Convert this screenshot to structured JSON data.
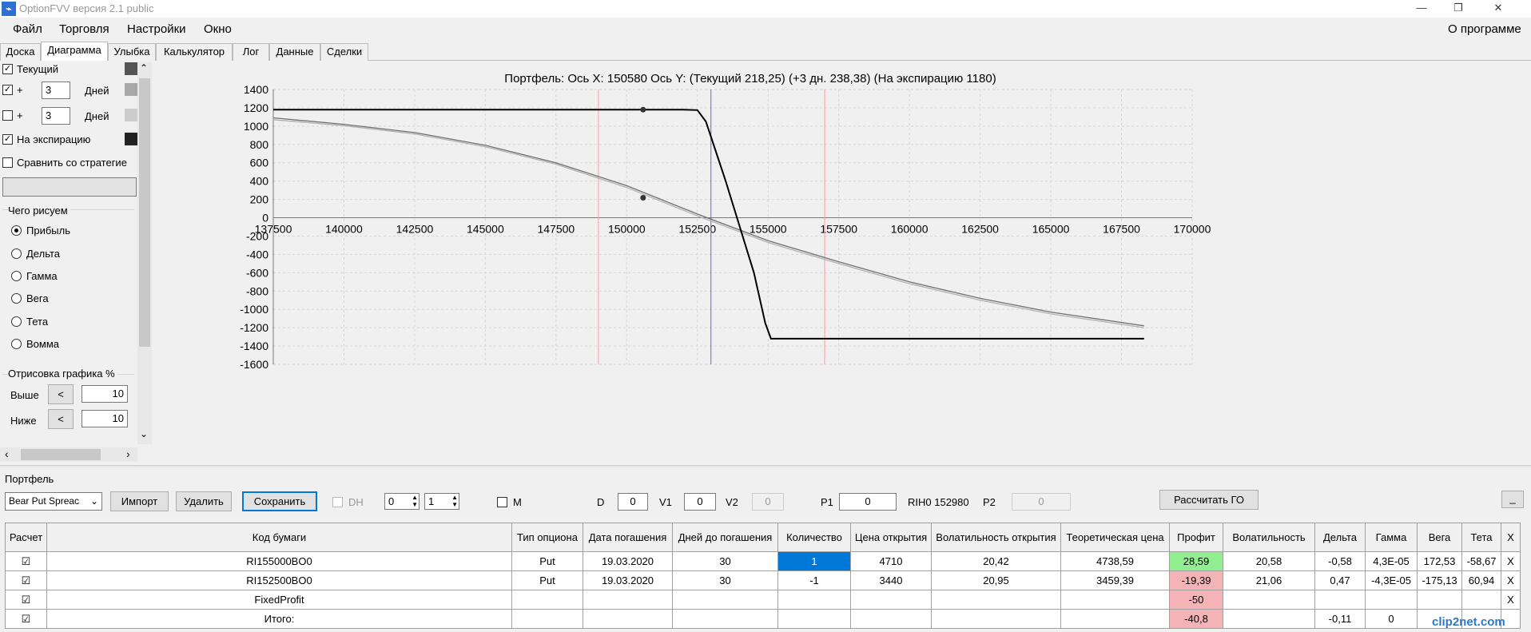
{
  "window": {
    "title": "OptionFVV версия 2.1 public",
    "app_icon": "chart-icon",
    "minimize": "—",
    "restore": "❐",
    "close": "✕"
  },
  "menu": {
    "items": [
      "Файл",
      "Торговля",
      "Настройки",
      "Окно"
    ],
    "about": "О программе"
  },
  "tabs": [
    "Доска",
    "Диаграмма",
    "Улыбка",
    "Калькулятор",
    "Лог",
    "Данные",
    "Сделки"
  ],
  "active_tab": "Диаграмма",
  "sidebar": {
    "current_label": "Текущий",
    "current_checked": true,
    "plus1": {
      "checked": true,
      "sign": "+",
      "days": "3",
      "unit": "Дней"
    },
    "plus2": {
      "checked": false,
      "sign": "+",
      "days": "3",
      "unit": "Дней"
    },
    "expiry_label": "На экспирацию",
    "expiry_checked": true,
    "compare_label": "Сравнить со стратегие",
    "compare_checked": false,
    "draw_group_title": "Чего рисуем",
    "draw_options": [
      "Прибыль",
      "Дельта",
      "Гамма",
      "Вега",
      "Тета",
      "Вомма"
    ],
    "draw_selected": "Прибыль",
    "render_group_title": "Отрисовка графика %",
    "above_label": "Выше",
    "above_btn": "<",
    "above_value": "10",
    "below_label": "Ниже",
    "below_btn": "<",
    "below_value": "10",
    "swatch_colors": [
      "#555555",
      "#a8a8a8",
      "#cccccc",
      "#222222"
    ],
    "scroll_up": "⌃",
    "scroll_down": "⌄",
    "scroll_left": "‹",
    "scroll_right": "›"
  },
  "chart_data": {
    "type": "line",
    "title": "Портфель: Ось X: 150580 Ось Y:  (Текущий 218,25)  (+3 дн. 238,38)  (На экспирацию 1180)",
    "x_ticks": [
      "137500",
      "140000",
      "142500",
      "145000",
      "147500",
      "150000",
      "152500",
      "155000",
      "157500",
      "160000",
      "162500",
      "165000",
      "167500",
      "170000"
    ],
    "y_ticks": [
      "1400",
      "1200",
      "1000",
      "800",
      "600",
      "400",
      "200",
      "0",
      "-200",
      "-400",
      "-600",
      "-800",
      "-1000",
      "-1200",
      "-1400",
      "-1600"
    ],
    "xlim": [
      137500,
      170000
    ],
    "ylim": [
      -1600,
      1400
    ],
    "grid": true,
    "vertical_lines": [
      {
        "x": 149000,
        "color": "#ff9aaa"
      },
      {
        "x": 152980,
        "color": "#6b6bb5"
      },
      {
        "x": 157000,
        "color": "#ff9aaa"
      }
    ],
    "markers": [
      {
        "x": 150580,
        "y": 1180
      },
      {
        "x": 150580,
        "y": 218
      }
    ],
    "series": [
      {
        "color": "#000000",
        "x": [
          137500,
          152000,
          152500,
          152800,
          153500,
          154500,
          154900,
          155100,
          168300
        ],
        "y": [
          1180,
          1180,
          1175,
          1050,
          400,
          -600,
          -1150,
          -1320,
          -1320
        ]
      },
      {
        "color": "#707070",
        "x": [
          137500,
          140000,
          142500,
          145000,
          147500,
          150000,
          152500,
          155000,
          157500,
          160000,
          162500,
          165000,
          168300
        ],
        "y": [
          1090,
          1020,
          930,
          790,
          600,
          350,
          40,
          -250,
          -480,
          -700,
          -880,
          -1030,
          -1180
        ]
      },
      {
        "color": "#b0b0b0",
        "x": [
          137500,
          140000,
          142500,
          145000,
          147500,
          150000,
          152500,
          155000,
          157500,
          160000,
          162500,
          165000,
          168300
        ],
        "y": [
          1070,
          1005,
          915,
          775,
          585,
          330,
          20,
          -270,
          -500,
          -720,
          -900,
          -1050,
          -1200
        ]
      }
    ]
  },
  "portfolio": {
    "section_label": "Портфель",
    "strategy_select": "Bear Put Spreac",
    "import_btn": "Импорт",
    "delete_btn": "Удалить",
    "save_btn": "Сохранить",
    "dh_label": "DH",
    "spin1": "0",
    "spin2": "1",
    "m_label": "M",
    "d_label": "D",
    "d_value": "0",
    "v1_label": "V1",
    "v1_value": "0",
    "v2_label": "V2",
    "v2_value": "0",
    "p1_label": "P1",
    "p1_value": "0",
    "rih_label": "RIH0 152980",
    "p2_label": "P2",
    "p2_value": "0",
    "calc_btn": "Рассчитать ГО",
    "collapse_btn": "_"
  },
  "table": {
    "columns": [
      "Расчет",
      "Код бумаги",
      "Тип опциона",
      "Дата погашения",
      "Дней до погашения",
      "Количество",
      "Цена открытия",
      "Волатильность открытия",
      "Теоретическая цена",
      "Профит",
      "Волатильность",
      "Дельта",
      "Гамма",
      "Вега",
      "Тета",
      "X"
    ],
    "rows": [
      {
        "check": "☑",
        "cells": [
          "RI155000BO0",
          "Put",
          "19.03.2020",
          "30",
          "1",
          "4710",
          "20,42",
          "4738,59",
          "28,59",
          "20,58",
          "-0,58",
          "4,3E-05",
          "172,53",
          "-58,67",
          "X"
        ]
      },
      {
        "check": "☑",
        "cells": [
          "RI152500BO0",
          "Put",
          "19.03.2020",
          "30",
          "-1",
          "3440",
          "20,95",
          "3459,39",
          "-19,39",
          "21,06",
          "0,47",
          "-4,3E-05",
          "-175,13",
          "60,94",
          "X"
        ]
      },
      {
        "check": "☑",
        "cells": [
          "FixedProfit",
          "",
          "",
          "",
          "",
          "",
          "",
          "",
          "-50",
          "",
          "",
          "",
          "",
          "",
          "X"
        ]
      },
      {
        "check": "☑",
        "cells": [
          "Итого:",
          "",
          "",
          "",
          "",
          "",
          "",
          "",
          "-40,8",
          "",
          "-0,11",
          "0",
          "",
          "",
          ""
        ]
      }
    ]
  },
  "watermark": "clip2net.com"
}
